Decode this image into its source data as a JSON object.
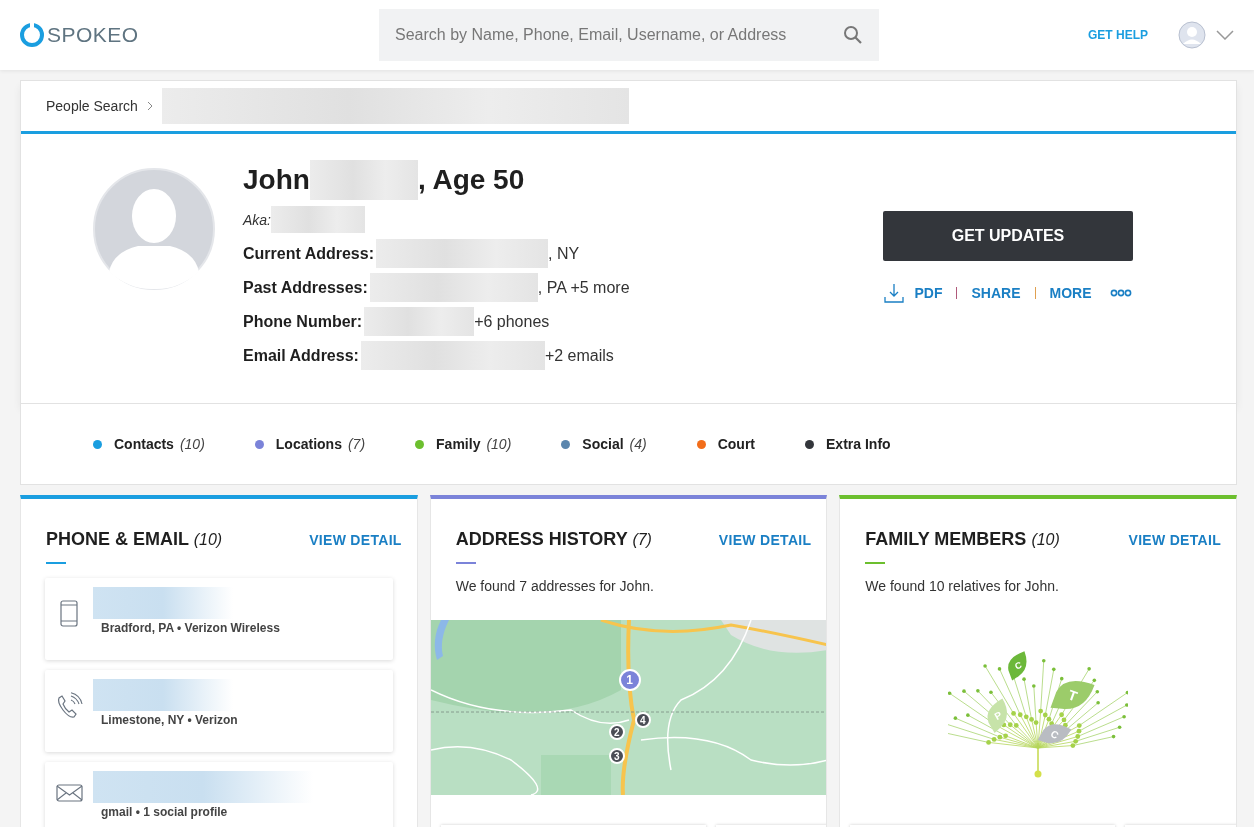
{
  "header": {
    "logo": "SPOKEO",
    "search": {
      "placeholder": "Search by Name, Phone, Email, Username, or Address"
    },
    "help_link": "GET HELP"
  },
  "breadcrumb": {
    "items": [
      "People Search"
    ]
  },
  "profile": {
    "first_name": "John",
    "age": ", Age 50",
    "aka_label": "Aka:",
    "fields": [
      {
        "label": "Current Address:",
        "suffix": ", NY"
      },
      {
        "label": "Past Addresses:",
        "suffix": ", PA +5 more"
      },
      {
        "label": "Phone Number:",
        "suffix": "+6 phones"
      },
      {
        "label": "Email Address:",
        "suffix": "+2 emails"
      }
    ],
    "primary_button": "GET UPDATES",
    "actions": [
      {
        "kind": "pdf",
        "label": "PDF"
      },
      {
        "kind": "link",
        "label": "SHARE"
      },
      {
        "kind": "link",
        "label": "MORE"
      },
      {
        "kind": "dots"
      }
    ]
  },
  "sections_nav": [
    {
      "label": "Contacts",
      "count": "(10)",
      "color": "#1a9ee0"
    },
    {
      "label": "Locations",
      "count": "(7)",
      "color": "#7b83d9"
    },
    {
      "label": "Family",
      "count": "(10)",
      "color": "#6cbf2e"
    },
    {
      "label": "Social",
      "count": "(4)",
      "color": "#5b86ad"
    },
    {
      "label": "Court",
      "color": "#f26d1a"
    },
    {
      "label": "Extra Info",
      "color": "#33363b"
    }
  ],
  "cards": [
    {
      "kind": "contacts",
      "title": "PHONE & EMAIL",
      "count": "(10)",
      "link": "VIEW DETAIL",
      "color": "#1a9ee0",
      "items": [
        {
          "kind": "mobile",
          "detail": "Bradford, PA • Verizon Wireless"
        },
        {
          "kind": "landline",
          "detail": "Limestone, NY • Verizon"
        },
        {
          "kind": "email",
          "detail": "gmail • 1 social profile"
        }
      ]
    },
    {
      "kind": "map",
      "title": "ADDRESS HISTORY",
      "count": "(7)",
      "link": "VIEW DETAIL",
      "color": "#7b83d9",
      "text": "We found 7 addresses for John.",
      "markers": [
        {
          "label": "1",
          "color": "#7b83d9"
        },
        {
          "label": "2",
          "color": "#4a4d55"
        },
        {
          "label": "3",
          "color": "#4a4d55"
        },
        {
          "label": "4",
          "color": "#4a4d55"
        }
      ]
    },
    {
      "kind": "tree",
      "title": "FAMILY MEMBERS",
      "count": "(10)",
      "link": "VIEW DETAIL",
      "color": "#6cbf2e",
      "text": "We found 10 relatives for John.",
      "leaves": [
        {
          "label": "C",
          "color": "#6cb83a"
        },
        {
          "label": "T",
          "color": "#9ccc6a"
        },
        {
          "label": "P",
          "color": "#c7e3a9"
        },
        {
          "label": "C",
          "color": "#b9bcc2"
        }
      ]
    }
  ]
}
